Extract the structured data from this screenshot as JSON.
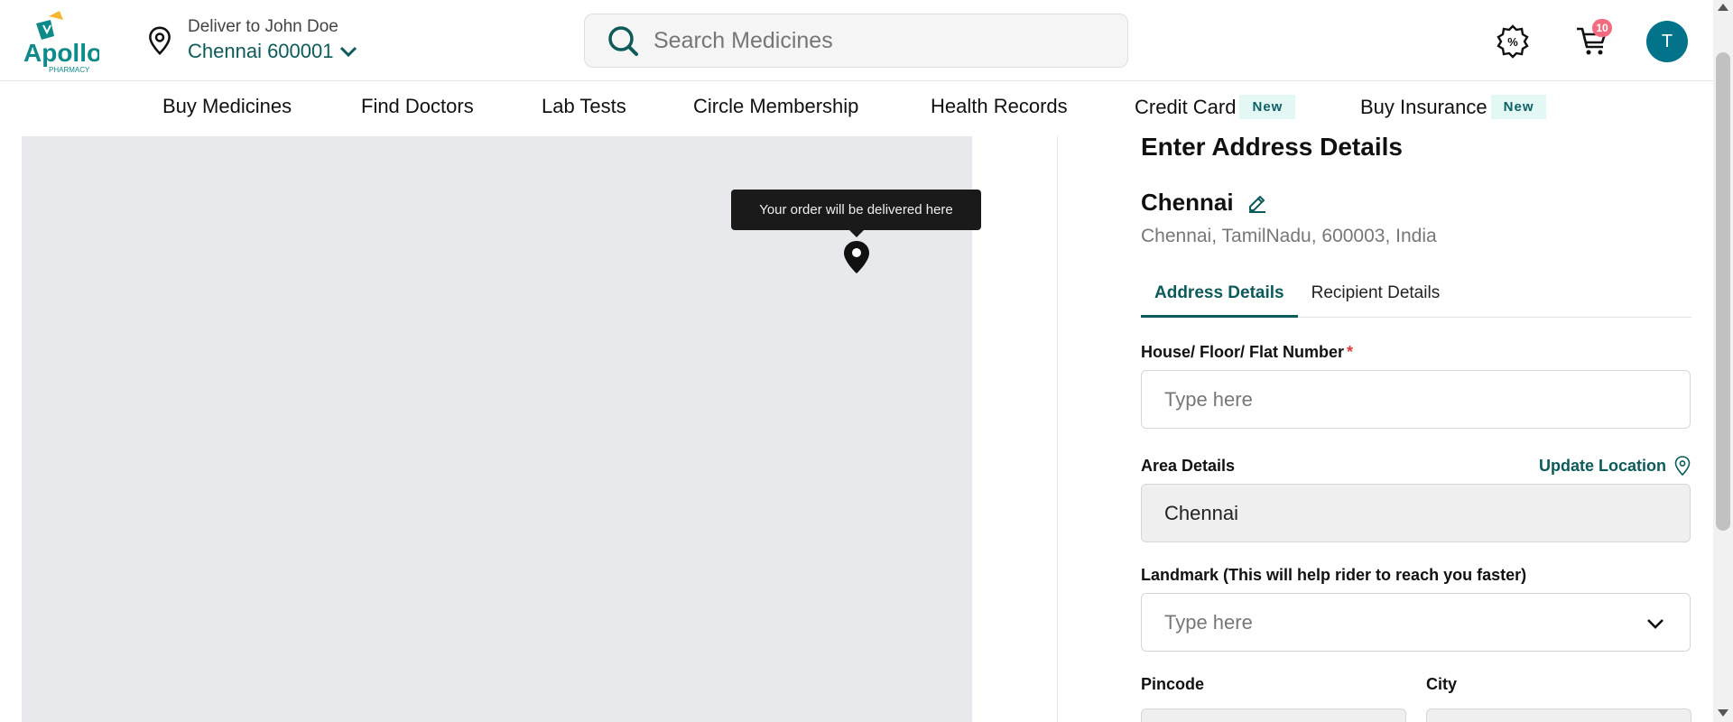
{
  "header": {
    "logo": {
      "brand": "Apollo",
      "sub": "PHARMACY",
      "icon": "apollo-logo"
    },
    "deliver": {
      "label": "Deliver to John Doe",
      "location": "Chennai 600001"
    },
    "search": {
      "placeholder": "Search Medicines"
    },
    "cart_count": "10",
    "avatar_initial": "T"
  },
  "nav": {
    "items": [
      {
        "label": "Buy Medicines"
      },
      {
        "label": "Find Doctors"
      },
      {
        "label": "Lab Tests"
      },
      {
        "label": "Circle Membership"
      },
      {
        "label": "Health Records"
      },
      {
        "label": "Credit Card",
        "badge": "New"
      },
      {
        "label": "Buy Insurance",
        "badge": "New"
      }
    ]
  },
  "map": {
    "tooltip": "Your order will be delivered here"
  },
  "panel": {
    "title": "Enter Address Details",
    "city": "Chennai",
    "address": "Chennai, TamilNadu, 600003, India",
    "tabs": [
      {
        "label": "Address Details",
        "active": true
      },
      {
        "label": "Recipient Details",
        "active": false
      }
    ],
    "fields": {
      "house": {
        "label": "House/ Floor/ Flat Number",
        "required_mark": "*",
        "placeholder": "Type here"
      },
      "area": {
        "label": "Area Details",
        "value": "Chennai",
        "action": "Update Location"
      },
      "landmark": {
        "label": "Landmark (This will help rider to reach you faster)",
        "placeholder": "Type here"
      },
      "pincode": {
        "label": "Pincode"
      },
      "city": {
        "label": "City"
      }
    }
  },
  "colors": {
    "brand_teal": "#0d5a5a",
    "badge_pink": "#f26b7e",
    "avatar_bg": "#02738a",
    "map_bg": "#e8e9ec"
  }
}
